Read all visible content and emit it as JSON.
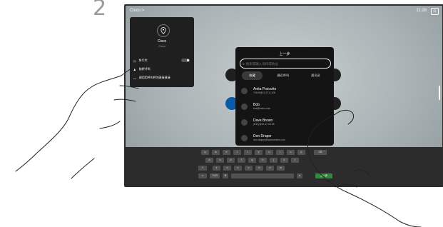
{
  "step_number": "2",
  "topbar": {
    "breadcrumb": "Cisco >",
    "time": "11:28"
  },
  "profile": {
    "name": "Cisco",
    "subtitle": "Cisco",
    "items": [
      "免打扰",
      "前期呼叫",
      "调用用呼叫呼叫直接直接"
    ]
  },
  "dialog": {
    "title": "上一步",
    "search_placeholder": "搜索或输入号码或地址",
    "tabs": [
      "收藏",
      "最近呼叫",
      "通讯录"
    ],
    "contacts": [
      {
        "name": "Anita Poscotto",
        "address": "74145@10.47.6.108"
      },
      {
        "name": "Bob",
        "address": "bob@cisco.com"
      },
      {
        "name": "Dave Brown",
        "address": "jenny@10.47.6.108"
      },
      {
        "name": "Don Draper",
        "address": "don.draper@somewhere.com"
      }
    ]
  },
  "keyboard": {
    "row1": [
      "q",
      "w",
      "e",
      "r",
      "t",
      "y",
      "u",
      "i",
      "o",
      "p"
    ],
    "row2": [
      "a",
      "s",
      "d",
      "f",
      "g",
      "h",
      "j",
      "k",
      "l"
    ],
    "row3": [
      "z",
      "x",
      "c",
      "v",
      "b",
      "n",
      "m"
    ],
    "mode_key": "?123",
    "enter_key": "上一步"
  },
  "colors": {
    "accent_blue": "#0b5aa8",
    "enter_green": "#2f8a3e"
  }
}
